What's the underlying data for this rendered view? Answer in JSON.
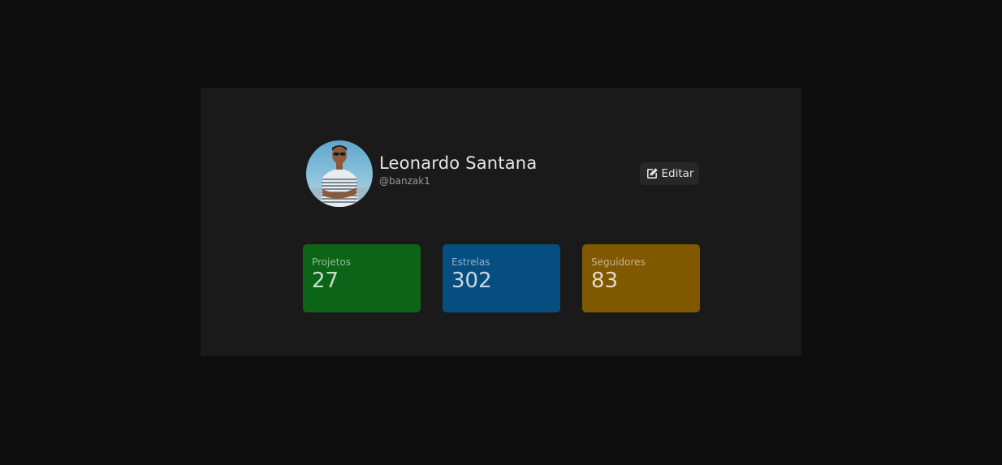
{
  "profile": {
    "name": "Leonardo Santana",
    "username": "@banzak1",
    "avatar_icon": "user-photo"
  },
  "actions": {
    "edit_label": "Editar",
    "edit_icon": "edit-icon"
  },
  "stats": [
    {
      "label": "Projetos",
      "value": "27",
      "color": "#0c6516"
    },
    {
      "label": "Estrelas",
      "value": "302",
      "color": "#064e7f"
    },
    {
      "label": "Seguidores",
      "value": "83",
      "color": "#805800"
    }
  ],
  "colors": {
    "page_bg": "#0e0e0e",
    "card_bg": "#1a1a1a",
    "button_bg": "#272727"
  }
}
